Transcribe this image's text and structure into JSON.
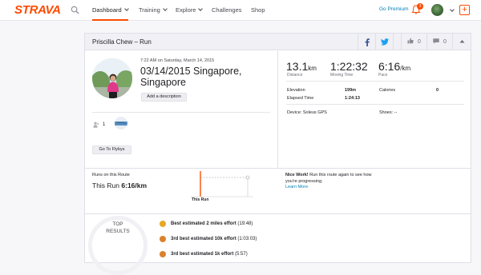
{
  "topbar": {
    "logo": "STRAVA",
    "nav": [
      {
        "label": "Dashboard",
        "active": true,
        "has_dropdown": true
      },
      {
        "label": "Training",
        "active": false,
        "has_dropdown": true
      },
      {
        "label": "Explore",
        "active": false,
        "has_dropdown": true
      },
      {
        "label": "Challenges",
        "active": false,
        "has_dropdown": false
      },
      {
        "label": "Shop",
        "active": false,
        "has_dropdown": false
      }
    ],
    "go_premium": "Go Premium",
    "notification_count": "3",
    "icons": {
      "search": "search-icon",
      "bell": "bell-icon",
      "avatar": "avatar",
      "add": "plus-icon"
    }
  },
  "activity": {
    "header_title": "Priscilla Chew – Run",
    "header_buttons": {
      "kudos_count": "0",
      "comments_count": "0"
    },
    "time": "7:22 AM on Saturday, March 14, 2015",
    "name": "03/14/2015 Singapore, Singapore",
    "add_description": "Add a description",
    "kudos_people_count": "1",
    "flyby_button": "Go To Flybys",
    "stats": [
      {
        "value": "13.1",
        "unit": "km",
        "label": "Distance"
      },
      {
        "value": "1:22:32",
        "unit": "",
        "label": "Moving Time"
      },
      {
        "value": "6:16",
        "unit": "/km",
        "label": "Pace"
      }
    ],
    "details": {
      "elevation_label": "Elevation",
      "elevation_value": "199m",
      "calories_label": "Calories",
      "calories_value": "0",
      "elapsed_label": "Elapsed Time",
      "elapsed_value": "1:24:13",
      "device": "Device: Soleus GPS",
      "shoes": "Shoes: --"
    }
  },
  "route": {
    "label": "Runs on this Route",
    "this_run_prefix": "This Run",
    "this_run_pace": "6:16/km",
    "chart_label": "This Run",
    "nice_work_title": "Nice Work!",
    "nice_work_text": "Run this route again to see how you're progressing.",
    "learn_more": "Learn More"
  },
  "results": {
    "heading_line1": "TOP",
    "heading_line2": "RESULTS",
    "items": [
      {
        "rank": "1",
        "text": "Best estimated 2 miles effort",
        "detail": "(19:48)",
        "color": "#e5a823"
      },
      {
        "rank": "3",
        "text": "3rd best estimated 10k effort",
        "detail": "(1:03:03)",
        "color": "#d9812c"
      },
      {
        "rank": "3",
        "text": "3rd best estimated 1k effort",
        "detail": "(5:57)",
        "color": "#d9812c"
      }
    ]
  },
  "colors": {
    "brand": "#fc4c02",
    "link": "#007fb6",
    "facebook": "#3b5998",
    "twitter": "#1da1f2"
  }
}
